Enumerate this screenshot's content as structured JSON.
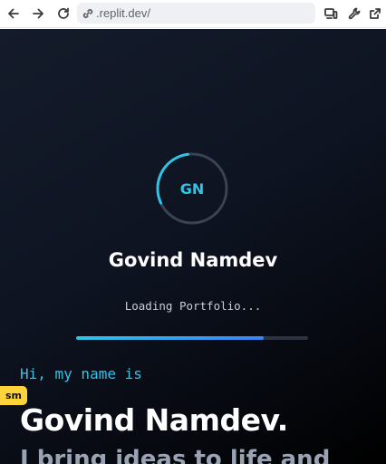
{
  "browser": {
    "url": ".replit.dev/",
    "icons": [
      "back-arrow-icon",
      "forward-arrow-icon",
      "reload-icon",
      "link-icon",
      "devices-icon",
      "wrench-icon",
      "open-external-icon"
    ]
  },
  "loader": {
    "initials": "GN",
    "name": "Govind Namdev",
    "status": "Loading Portfolio...",
    "ring_progress": 0.3,
    "bar_progress": 0.81,
    "accent": "#2fc4e8",
    "bar_gradient_end": "#3b82f6"
  },
  "hero": {
    "intro": "Hi, my name is",
    "name": "Govind Namdev.",
    "tagline": "I bring ideas to life and"
  },
  "breakpoint_badge": "sm",
  "colors": {
    "background": "#0e1422",
    "name_text": "#ffffff",
    "badge": "#ffd43b"
  }
}
